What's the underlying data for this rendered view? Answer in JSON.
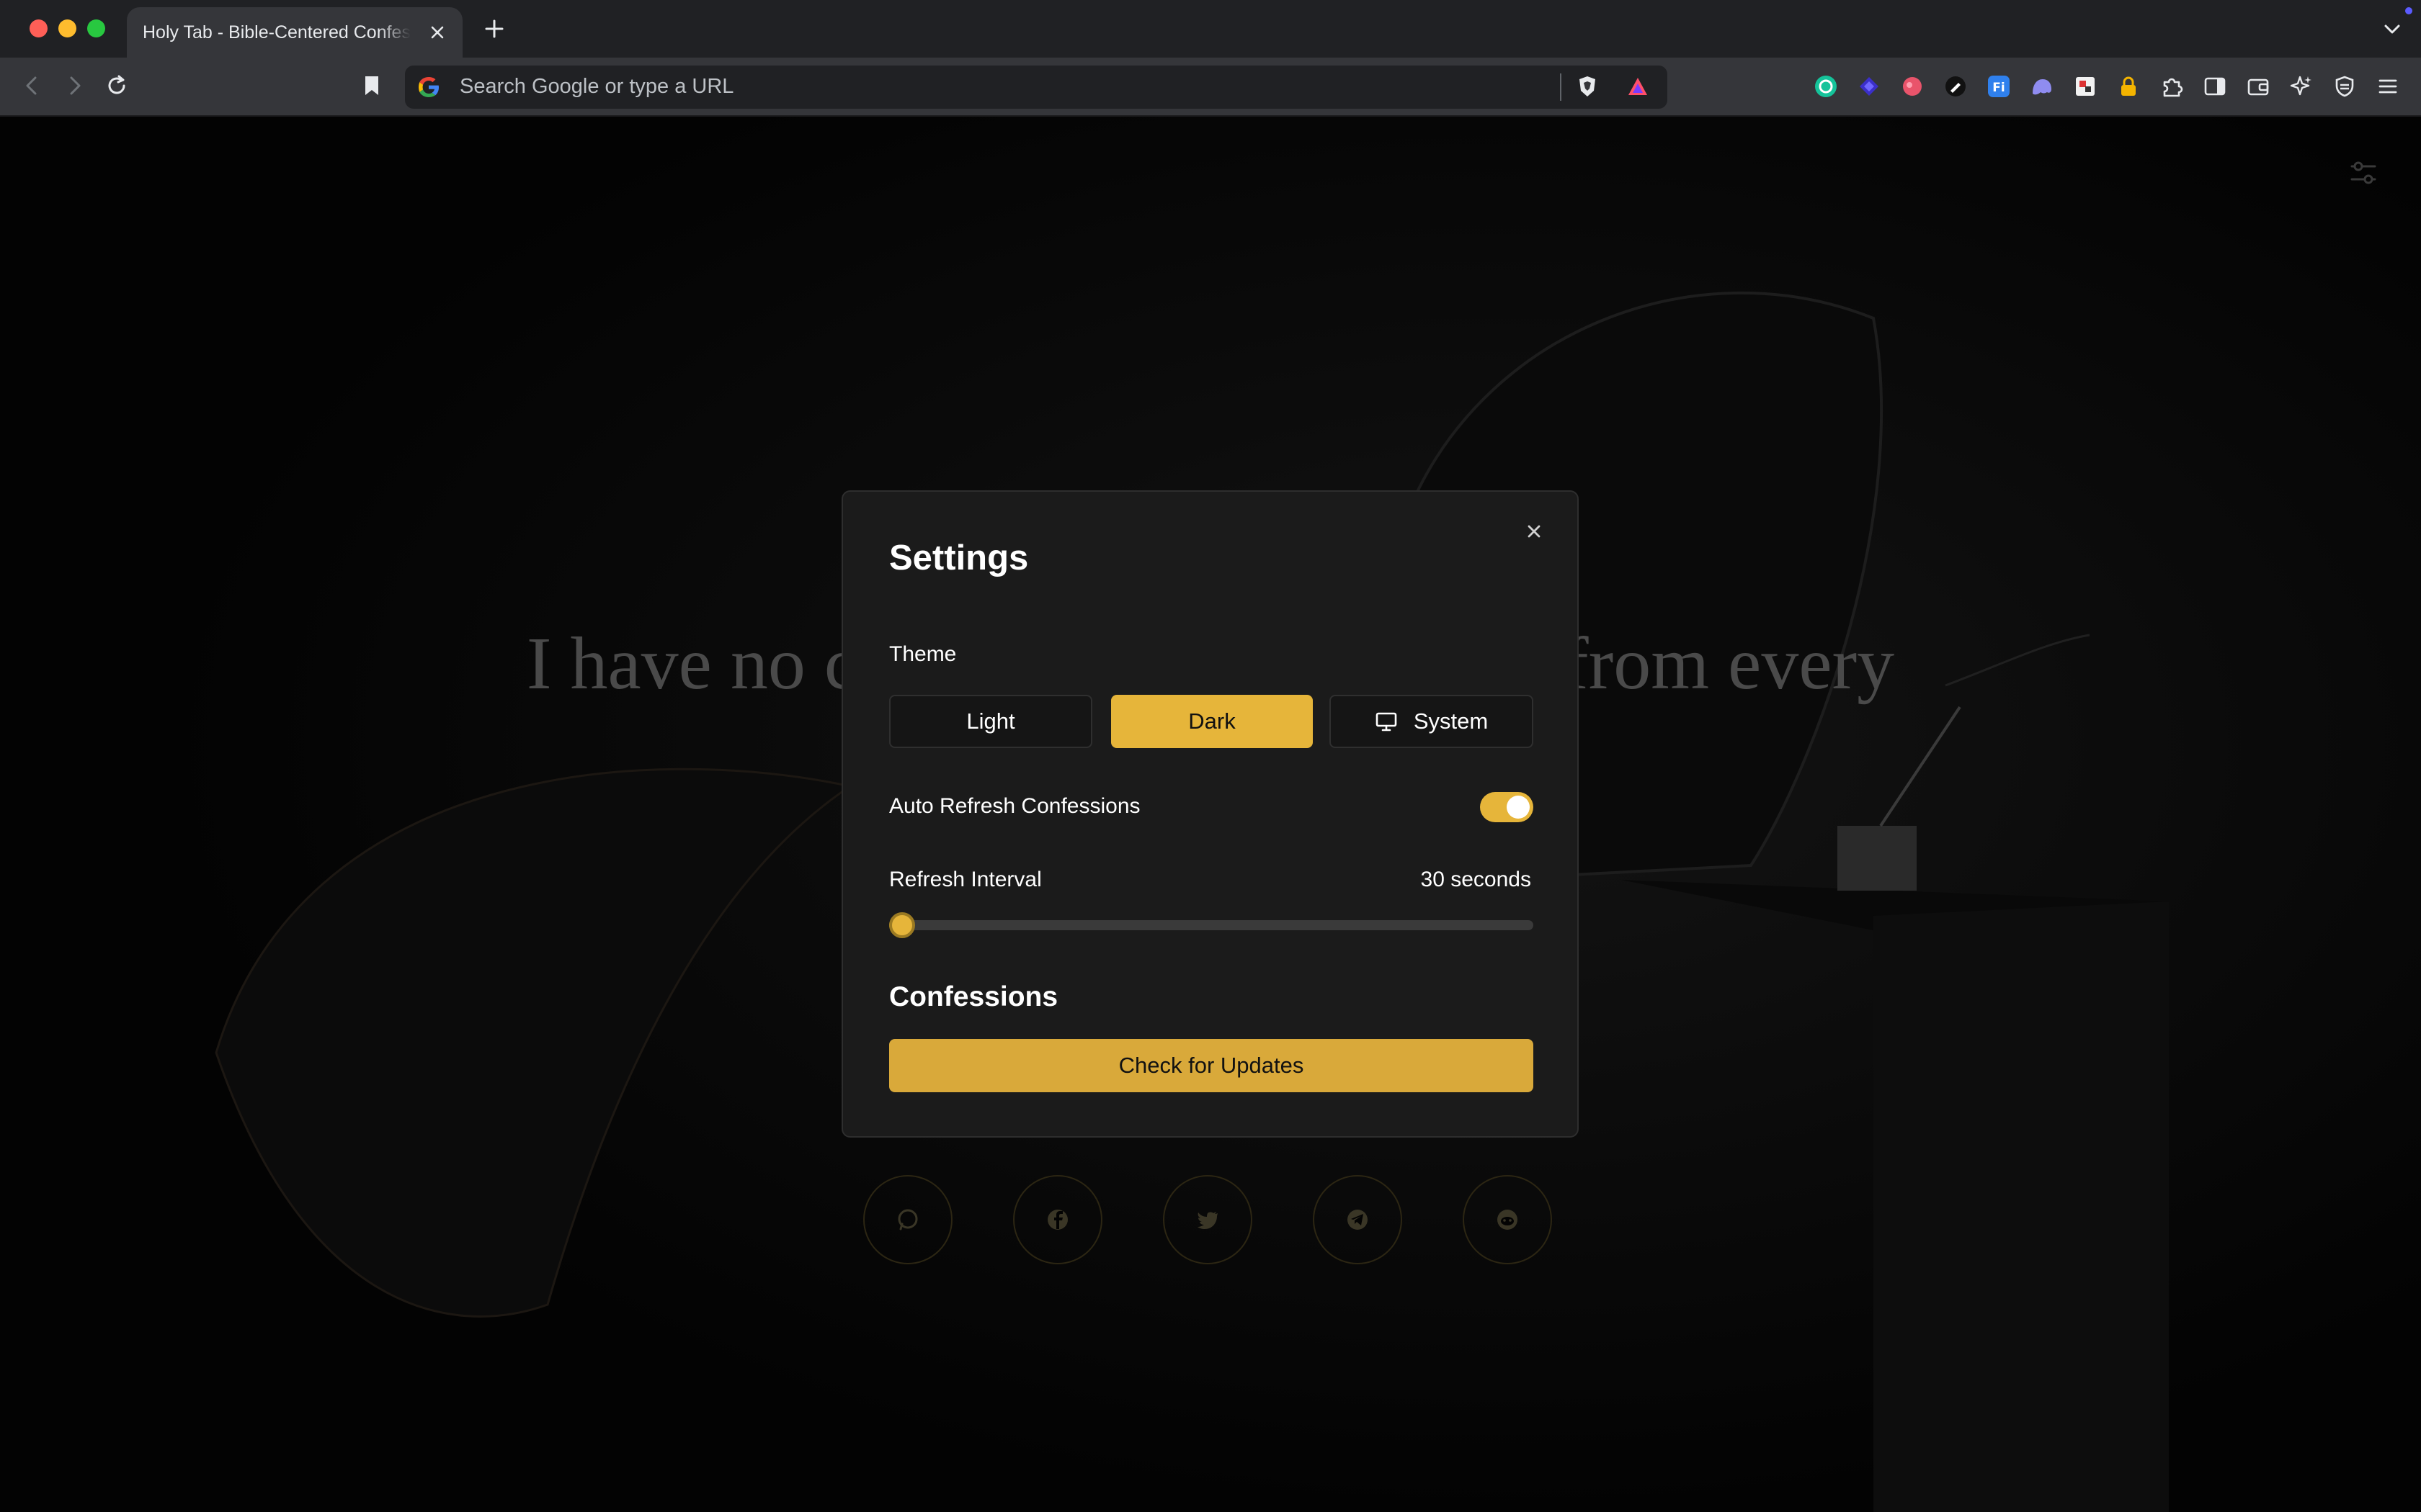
{
  "browser": {
    "tab_title": "Holy Tab - Bible-Centered Confessions",
    "omnibox_placeholder": "Search Google or type a URL"
  },
  "page": {
    "verse_left": "I have no c",
    "verse_right": "from every"
  },
  "settings": {
    "title": "Settings",
    "theme_label": "Theme",
    "theme_options": [
      "Light",
      "Dark",
      "System"
    ],
    "theme_selected": "Dark",
    "auto_refresh_label": "Auto Refresh Confessions",
    "auto_refresh_enabled": true,
    "refresh_interval_label": "Refresh Interval",
    "refresh_interval_value": "30 seconds",
    "refresh_interval_fraction": 0.0,
    "confessions_heading": "Confessions",
    "check_updates_label": "Check for Updates"
  },
  "share": [
    "whatsapp-icon",
    "facebook-icon",
    "twitter-icon",
    "telegram-icon",
    "reddit-icon"
  ],
  "colors": {
    "accent": "#e6b53a",
    "modal_bg": "#1b1b1b",
    "chrome_bg": "#35363a"
  }
}
